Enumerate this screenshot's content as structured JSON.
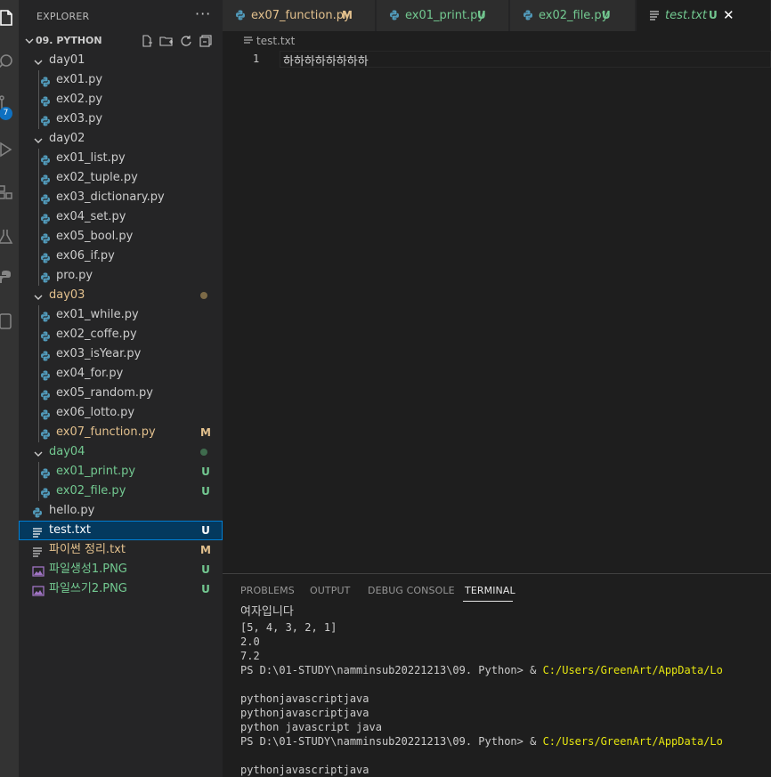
{
  "sidebar": {
    "title": "EXPLORER",
    "more": "···",
    "root_label": "09. PYTHON",
    "tree": [
      {
        "label": "day01",
        "kind": "folder",
        "color": "#cccccc"
      },
      {
        "label": "ex01.py",
        "kind": "py",
        "color": "#cccccc"
      },
      {
        "label": "ex02.py",
        "kind": "py",
        "color": "#cccccc"
      },
      {
        "label": "ex03.py",
        "kind": "py",
        "color": "#cccccc"
      },
      {
        "label": "day02",
        "kind": "folder",
        "color": "#cccccc"
      },
      {
        "label": "ex01_list.py",
        "kind": "py",
        "color": "#cccccc"
      },
      {
        "label": "ex02_tuple.py",
        "kind": "py",
        "color": "#cccccc"
      },
      {
        "label": "ex03_dictionary.py",
        "kind": "py",
        "color": "#cccccc"
      },
      {
        "label": "ex04_set.py",
        "kind": "py",
        "color": "#cccccc"
      },
      {
        "label": "ex05_bool.py",
        "kind": "py",
        "color": "#cccccc"
      },
      {
        "label": "ex06_if.py",
        "kind": "py",
        "color": "#cccccc"
      },
      {
        "label": "pro.py",
        "kind": "py",
        "color": "#cccccc"
      },
      {
        "label": "day03",
        "kind": "folder",
        "color": "#e2c08d",
        "dot": "#7c6a47"
      },
      {
        "label": "ex01_while.py",
        "kind": "py",
        "color": "#cccccc"
      },
      {
        "label": "ex02_coffe.py",
        "kind": "py",
        "color": "#cccccc"
      },
      {
        "label": "ex03_isYear.py",
        "kind": "py",
        "color": "#cccccc"
      },
      {
        "label": "ex04_for.py",
        "kind": "py",
        "color": "#cccccc"
      },
      {
        "label": "ex05_random.py",
        "kind": "py",
        "color": "#cccccc"
      },
      {
        "label": "ex06_lotto.py",
        "kind": "py",
        "color": "#cccccc"
      },
      {
        "label": "ex07_function.py",
        "kind": "py",
        "color": "#e2c08d",
        "deco": "M"
      },
      {
        "label": "day04",
        "kind": "folder",
        "color": "#73c991",
        "dot": "#3f6b4d"
      },
      {
        "label": "ex01_print.py",
        "kind": "py",
        "color": "#73c991",
        "deco": "U"
      },
      {
        "label": "ex02_file.py",
        "kind": "py",
        "color": "#73c991",
        "deco": "U"
      },
      {
        "label": "hello.py",
        "kind": "py",
        "color": "#cccccc"
      },
      {
        "label": "test.txt",
        "kind": "txt",
        "color": "#ffffff",
        "deco": "U",
        "selected": true
      },
      {
        "label": "파이썬 정리.txt",
        "kind": "txt",
        "color": "#e2c08d",
        "deco": "M"
      },
      {
        "label": "파일생성1.PNG",
        "kind": "png",
        "color": "#73c991",
        "deco": "U"
      },
      {
        "label": "파일쓰기2.PNG",
        "kind": "png",
        "color": "#73c991",
        "deco": "U"
      }
    ]
  },
  "activity": {
    "badge": "7"
  },
  "tabs": [
    {
      "label": "ex07_function.py",
      "deco": "M",
      "color": "#e2c08d",
      "kind": "py"
    },
    {
      "label": "ex01_print.py",
      "deco": "U",
      "color": "#73c991",
      "kind": "py"
    },
    {
      "label": "ex02_file.py",
      "deco": "U",
      "color": "#73c991",
      "kind": "py"
    },
    {
      "label": "test.txt",
      "deco": "U",
      "color": "#73c991",
      "kind": "txt",
      "active": true,
      "close": "✕"
    }
  ],
  "editor": {
    "breadcrumb": "test.txt",
    "line_number": "1",
    "line_text": "하하하하하하하하"
  },
  "panel": {
    "tabs": [
      "PROBLEMS",
      "OUTPUT",
      "DEBUG CONSOLE",
      "TERMINAL"
    ],
    "active_tab": "TERMINAL",
    "terminal": [
      {
        "text": "여자입니다",
        "korean": true
      },
      {
        "text": "[5, 4, 3, 2, 1]"
      },
      {
        "text": "2.0"
      },
      {
        "text": "7.2"
      },
      {
        "prompt": "PS D:\\01-STUDY\\namminsub20221213\\09. Python> & ",
        "path": "C:/Users/GreenArt/AppData/Lo"
      },
      {
        "text": ""
      },
      {
        "text": "pythonjavascriptjava"
      },
      {
        "text": "pythonjavascriptjava"
      },
      {
        "text": "python javascript java"
      },
      {
        "prompt": "PS D:\\01-STUDY\\namminsub20221213\\09. Python> & ",
        "path": "C:/Users/GreenArt/AppData/Lo"
      },
      {
        "text": ""
      },
      {
        "text": "pythonjavascriptjava"
      }
    ]
  },
  "colors": {
    "python_icon": "#519aba",
    "txt_icon": "#cccccc",
    "png_icon": "#a074c4"
  }
}
